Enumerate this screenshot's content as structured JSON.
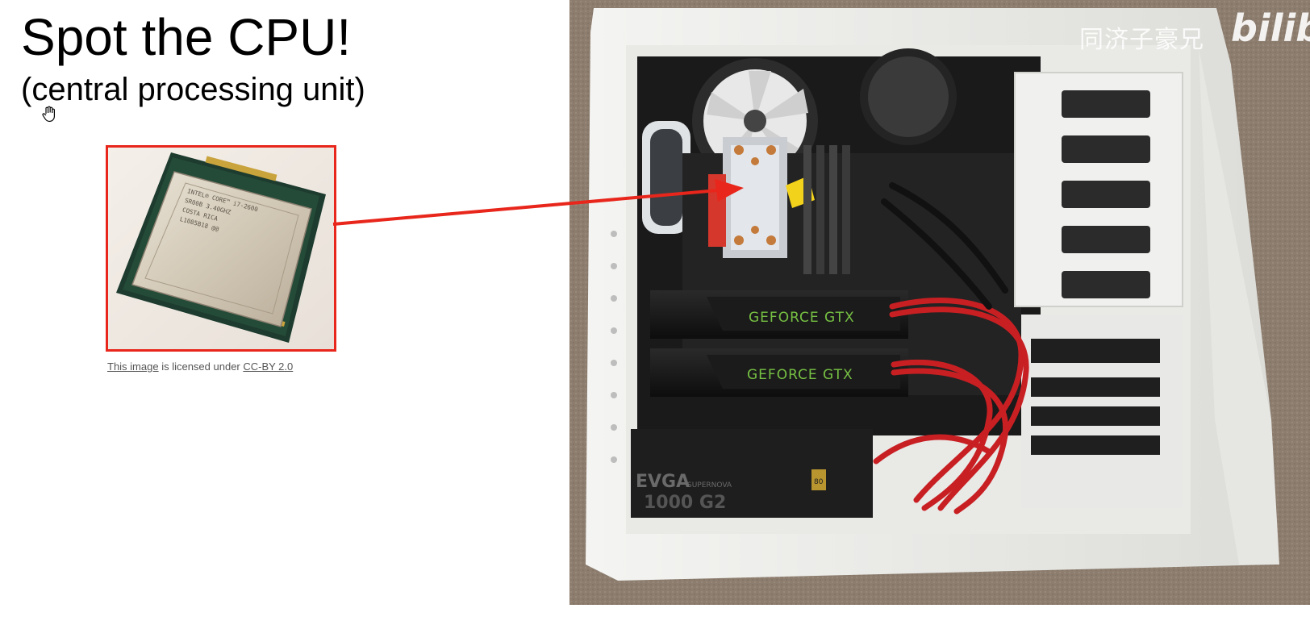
{
  "slide": {
    "title": "Spot the CPU!",
    "subtitle": "(central processing unit)"
  },
  "cpu_image": {
    "chip_text_lines": [
      "INTEL® CORE™ i7-2600",
      "SR00B 3.40GHZ",
      "COSTA RICA",
      "L1085B18 @@"
    ],
    "accent_color": "#e8261b"
  },
  "credit": {
    "link1_text": "This image",
    "middle_text": " is licensed under ",
    "link2_text": "CC-BY 2.0"
  },
  "pc_photo": {
    "gpu_label_top": "GEFORCE GTX",
    "gpu_label_bottom": "GEFORCE GTX",
    "psu_brand": "EVGA",
    "psu_series": "SUPERNOVA",
    "psu_model": "1000 G2",
    "psu_badge": "80"
  },
  "watermark": {
    "channel": "同济子豪兄",
    "logo": "bilibili"
  },
  "icons": {
    "cursor": "hand-cursor-icon"
  }
}
